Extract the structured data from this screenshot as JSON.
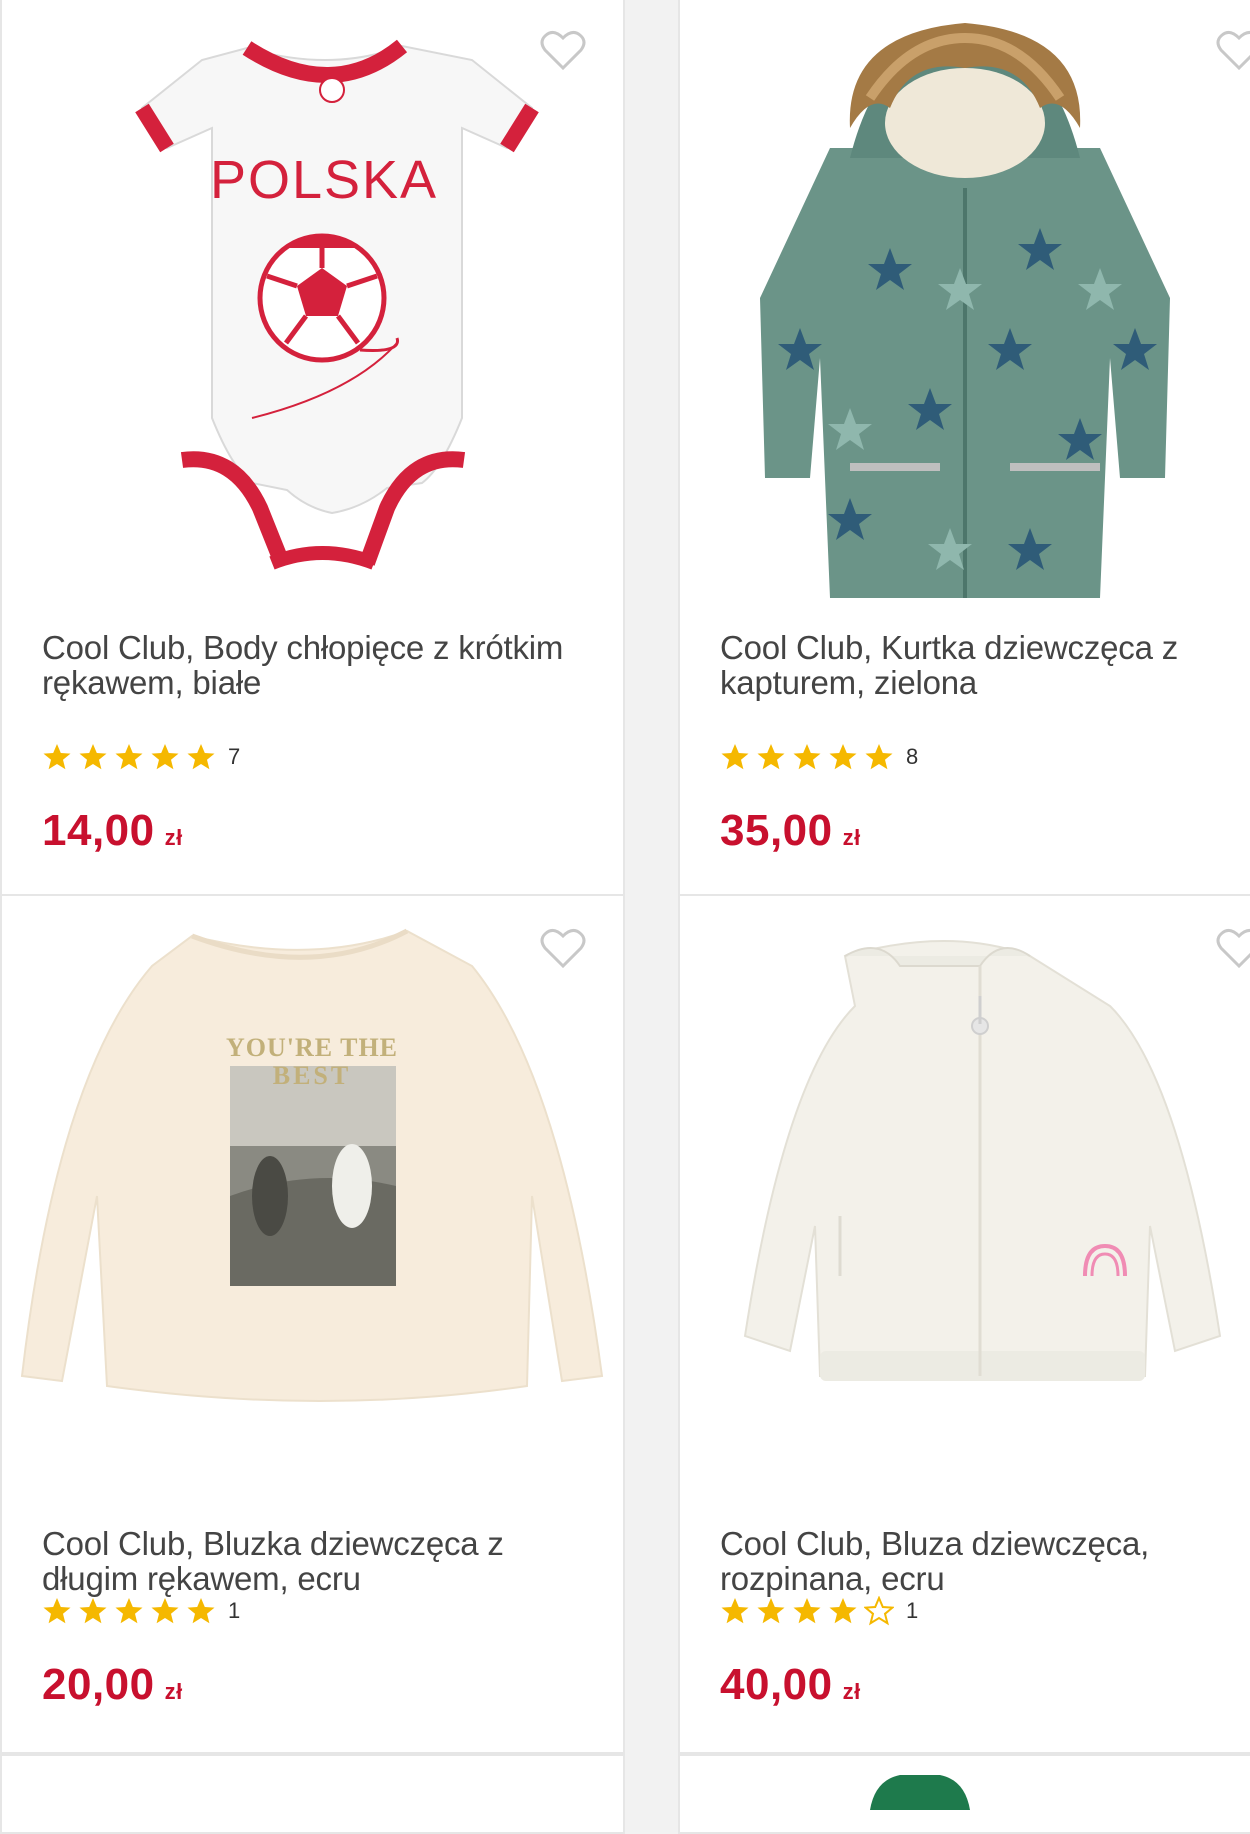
{
  "colors": {
    "price": "#c8102e",
    "star_filled": "#f5b800",
    "star_empty": "#f5b800",
    "heart_outline": "#c8c8c8"
  },
  "products": [
    {
      "title": "Cool Club, Body chłopięce z krótkim rękawem, białe",
      "rating": 5,
      "reviews": "7",
      "price": "14,00",
      "currency": "zł",
      "image": "white-bodysuit-polska-football"
    },
    {
      "title": "Cool Club, Kurtka dziewczęca z kapturem, zielona",
      "rating": 5,
      "reviews": "8",
      "price": "35,00",
      "currency": "zł",
      "image": "green-star-print-parka"
    },
    {
      "title": "Cool Club, Bluzka dziewczęca z długim rękawem, ecru",
      "rating": 5,
      "reviews": "1",
      "price": "20,00",
      "currency": "zł",
      "image": "ecru-longsleeve-photo-print"
    },
    {
      "title": "Cool Club, Bluza dziewczęca, rozpinana, ecru",
      "rating": 4,
      "reviews": "1",
      "price": "40,00",
      "currency": "zł",
      "image": "ecru-fleece-zip-jacket"
    }
  ]
}
